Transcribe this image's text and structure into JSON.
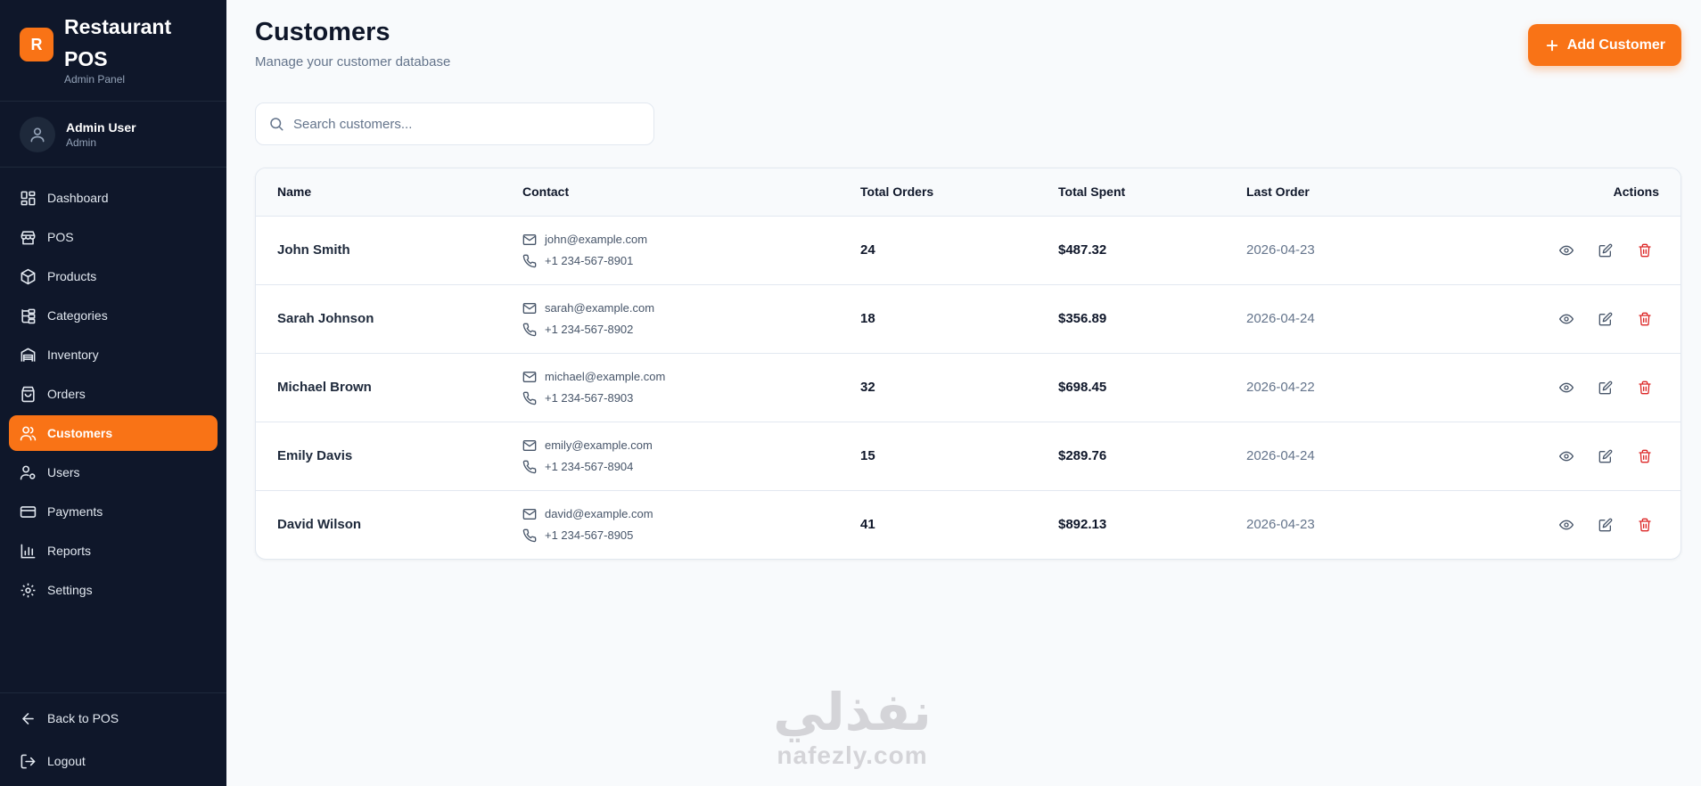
{
  "brand": {
    "logo_letter": "R",
    "title": "Restaurant POS",
    "subtitle": "Admin Panel",
    "accent": "#f97316"
  },
  "user": {
    "name": "Admin User",
    "role": "Admin"
  },
  "nav": [
    {
      "label": "Dashboard",
      "icon": "dashboard-icon"
    },
    {
      "label": "POS",
      "icon": "store-icon"
    },
    {
      "label": "Products",
      "icon": "package-icon"
    },
    {
      "label": "Categories",
      "icon": "categories-icon"
    },
    {
      "label": "Inventory",
      "icon": "warehouse-icon"
    },
    {
      "label": "Orders",
      "icon": "shopping-bag-icon"
    },
    {
      "label": "Customers",
      "icon": "users-icon",
      "active": true
    },
    {
      "label": "Users",
      "icon": "user-cog-icon"
    },
    {
      "label": "Payments",
      "icon": "credit-card-icon"
    },
    {
      "label": "Reports",
      "icon": "bar-chart-icon"
    },
    {
      "label": "Settings",
      "icon": "gear-icon"
    }
  ],
  "bottom_nav": [
    {
      "label": "Back to POS",
      "icon": "arrow-left-icon"
    },
    {
      "label": "Logout",
      "icon": "logout-icon"
    }
  ],
  "page": {
    "title": "Customers",
    "subtitle": "Manage your customer database",
    "add_label": "Add Customer"
  },
  "search": {
    "placeholder": "Search customers..."
  },
  "table": {
    "headers": {
      "name": "Name",
      "contact": "Contact",
      "orders": "Total Orders",
      "spent": "Total Spent",
      "last": "Last Order",
      "actions": "Actions"
    },
    "rows": [
      {
        "name": "John Smith",
        "email": "john@example.com",
        "phone": "+1 234-567-8901",
        "orders": "24",
        "spent": "$487.32",
        "last": "2026-04-23"
      },
      {
        "name": "Sarah Johnson",
        "email": "sarah@example.com",
        "phone": "+1 234-567-8902",
        "orders": "18",
        "spent": "$356.89",
        "last": "2026-04-24"
      },
      {
        "name": "Michael Brown",
        "email": "michael@example.com",
        "phone": "+1 234-567-8903",
        "orders": "32",
        "spent": "$698.45",
        "last": "2026-04-22"
      },
      {
        "name": "Emily Davis",
        "email": "emily@example.com",
        "phone": "+1 234-567-8904",
        "orders": "15",
        "spent": "$289.76",
        "last": "2026-04-24"
      },
      {
        "name": "David Wilson",
        "email": "david@example.com",
        "phone": "+1 234-567-8905",
        "orders": "41",
        "spent": "$892.13",
        "last": "2026-04-23"
      }
    ]
  },
  "watermark": {
    "arabic": "نفذلي",
    "latin": "nafezly.com"
  }
}
